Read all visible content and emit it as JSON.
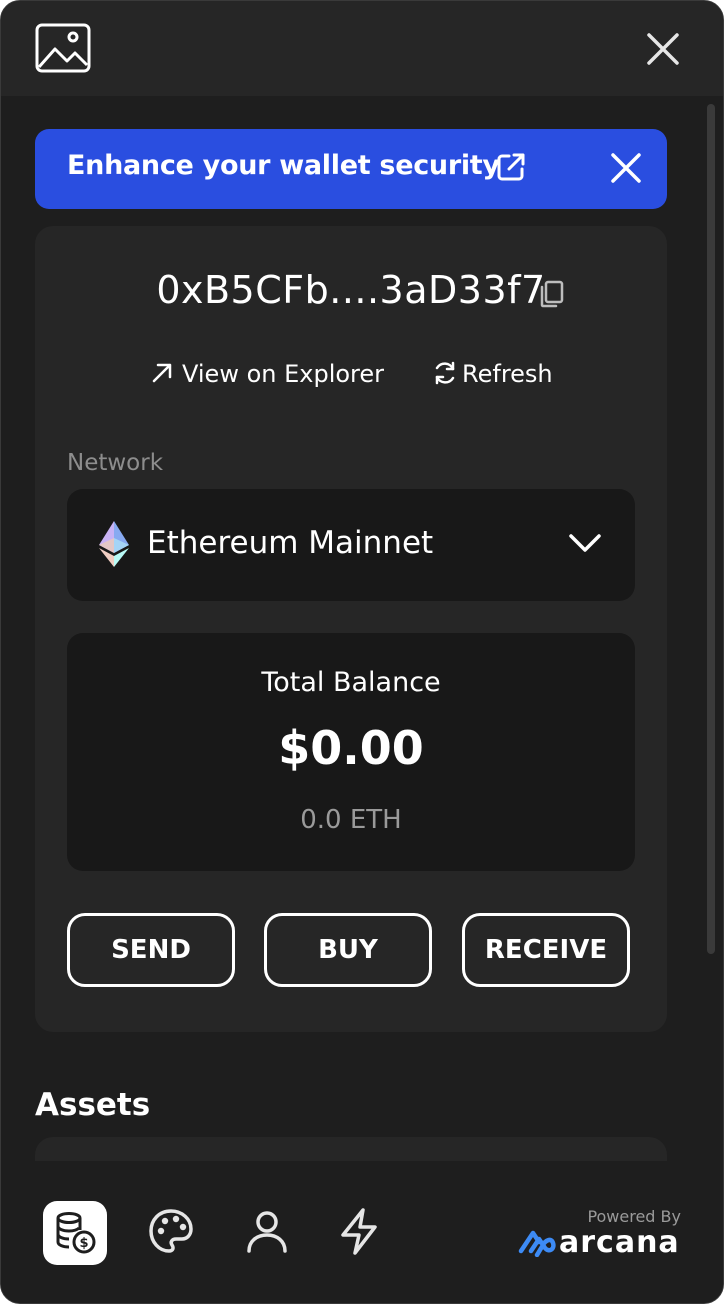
{
  "banner": {
    "text": "Enhance your wallet security"
  },
  "wallet": {
    "address": "0xB5CFb....3aD33f7",
    "view_explorer": "View on Explorer",
    "refresh": "Refresh"
  },
  "network": {
    "label": "Network",
    "selected": "Ethereum Mainnet"
  },
  "balance": {
    "label": "Total Balance",
    "value": "$0.00",
    "eth": "0.0 ETH"
  },
  "actions": {
    "send": "SEND",
    "buy": "BUY",
    "receive": "RECEIVE"
  },
  "assets": {
    "title": "Assets"
  },
  "footer": {
    "powered_by": "Powered By",
    "brand": "arcana"
  },
  "colors": {
    "accent": "#2a4ee0",
    "background": "#1e1e1e",
    "card": "#262626",
    "inset": "#181818"
  },
  "icons": [
    "image-icon",
    "close-icon",
    "external-link-icon",
    "copy-icon",
    "arrow-up-right-icon",
    "refresh-icon",
    "ethereum-icon",
    "chevron-down-icon",
    "coins-icon",
    "palette-icon",
    "user-icon",
    "lightning-icon",
    "arcana-logo-icon"
  ]
}
